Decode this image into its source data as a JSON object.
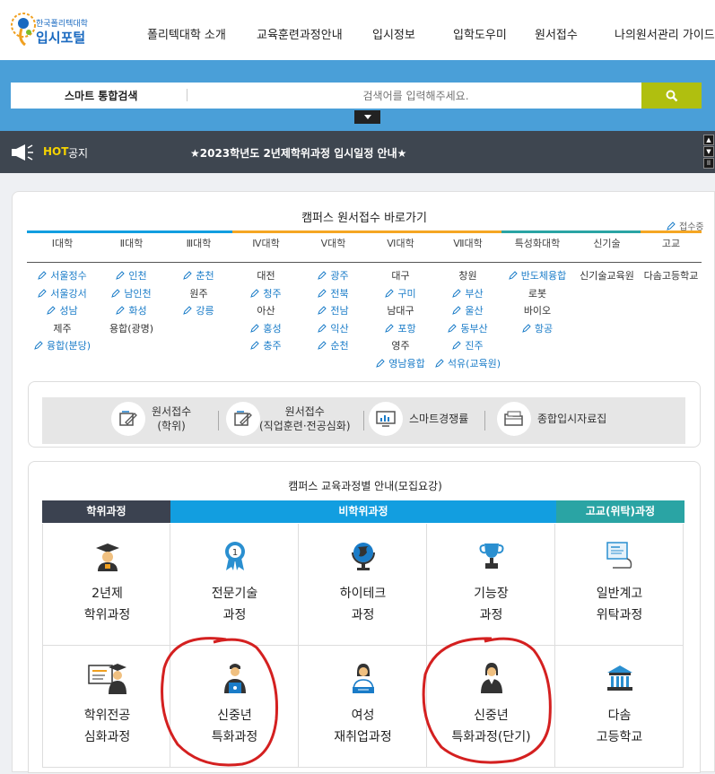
{
  "header": {
    "logo_small": "한국폴리텍대학",
    "logo_big": "입시포털",
    "nav": [
      "폴리텍대학 소개",
      "교육훈련과정안내",
      "입시정보",
      "입학도우미",
      "원서접수",
      "나의원서관리 가이드"
    ]
  },
  "search": {
    "label": "스마트 통합검색",
    "placeholder": "검색어를 입력해주세요.",
    "button_icon": "search-icon"
  },
  "hot": {
    "tag": "HOT",
    "label": "공지",
    "message": "★2023학년도 2년제학위과정 입시일정 안내★"
  },
  "campus": {
    "title": "캠퍼스 원서접수 바로가기",
    "legend": "접수중",
    "tabs": [
      "Ⅰ대학",
      "Ⅱ대학",
      "Ⅲ대학",
      "Ⅳ대학",
      "Ⅴ대학",
      "Ⅵ대학",
      "Ⅶ대학",
      "특성화대학",
      "신기술",
      "고교"
    ],
    "columns": [
      [
        {
          "t": "서울정수",
          "a": true
        },
        {
          "t": "서울강서",
          "a": true
        },
        {
          "t": "성남",
          "a": true
        },
        {
          "t": "제주",
          "a": false
        },
        {
          "t": "융합(분당)",
          "a": true
        }
      ],
      [
        {
          "t": "인천",
          "a": true
        },
        {
          "t": "남인천",
          "a": true
        },
        {
          "t": "화성",
          "a": true
        },
        {
          "t": "용합(광명)",
          "a": false
        }
      ],
      [
        {
          "t": "춘천",
          "a": true
        },
        {
          "t": "원주",
          "a": false
        },
        {
          "t": "강릉",
          "a": true
        }
      ],
      [
        {
          "t": "대전",
          "a": false
        },
        {
          "t": "청주",
          "a": true
        },
        {
          "t": "아산",
          "a": false
        },
        {
          "t": "홍성",
          "a": true
        },
        {
          "t": "충주",
          "a": true
        }
      ],
      [
        {
          "t": "광주",
          "a": true
        },
        {
          "t": "전북",
          "a": true
        },
        {
          "t": "전남",
          "a": true
        },
        {
          "t": "익산",
          "a": true
        },
        {
          "t": "순천",
          "a": true
        }
      ],
      [
        {
          "t": "대구",
          "a": false
        },
        {
          "t": "구미",
          "a": true
        },
        {
          "t": "남대구",
          "a": false
        },
        {
          "t": "포항",
          "a": true
        },
        {
          "t": "영주",
          "a": false
        },
        {
          "t": "영남융합",
          "a": true
        }
      ],
      [
        {
          "t": "창원",
          "a": false
        },
        {
          "t": "부산",
          "a": true
        },
        {
          "t": "울산",
          "a": true
        },
        {
          "t": "동부산",
          "a": true
        },
        {
          "t": "진주",
          "a": true
        },
        {
          "t": "석유(교육원)",
          "a": true
        }
      ],
      [
        {
          "t": "반도체융합",
          "a": true
        },
        {
          "t": "로봇",
          "a": false
        },
        {
          "t": "바이오",
          "a": false
        },
        {
          "t": "항공",
          "a": true
        }
      ],
      [
        {
          "t": "신기술교육원",
          "a": false
        }
      ],
      [
        {
          "t": "다솜고등학교",
          "a": false
        }
      ]
    ]
  },
  "quick": [
    {
      "label": "원서접수\n(학위)",
      "icon": "application-degree-icon"
    },
    {
      "label": "원서접수\n(직업훈련·전공심화)",
      "icon": "application-training-icon"
    },
    {
      "label": "스마트경쟁률",
      "icon": "chart-monitor-icon"
    },
    {
      "label": "종합입시자료집",
      "icon": "folder-icon"
    }
  ],
  "courses": {
    "title": "캠퍼스 교육과정별 안내(모집요강)",
    "headers": [
      "학위과정",
      "비학위과정",
      "고교(위탁)과정"
    ],
    "colors": {
      "degree": "#3b4250",
      "nondegree": "#129ee0",
      "highschool": "#2aa4a4",
      "annotation": "#d42020"
    },
    "row1": [
      {
        "label": "2년제\n학위과정",
        "icon": "graduation-cap-icon"
      },
      {
        "label": "전문기술\n과정",
        "icon": "medal-icon"
      },
      {
        "label": "하이테크\n과정",
        "icon": "globe-icon"
      },
      {
        "label": "기능장\n과정",
        "icon": "trophy-icon"
      },
      {
        "label": "일반계고\n위탁과정",
        "icon": "presentation-icon"
      }
    ],
    "row2": [
      {
        "label": "학위전공\n심화과정",
        "icon": "certificate-icon"
      },
      {
        "label": "신중년\n특화과정",
        "icon": "worker-icon"
      },
      {
        "label": "여성\n재취업과정",
        "icon": "woman-icon"
      },
      {
        "label": "신중년\n특화과정(단기)",
        "icon": "person-icon"
      },
      {
        "label": "다솜\n고등학교",
        "icon": "school-building-icon"
      }
    ]
  }
}
